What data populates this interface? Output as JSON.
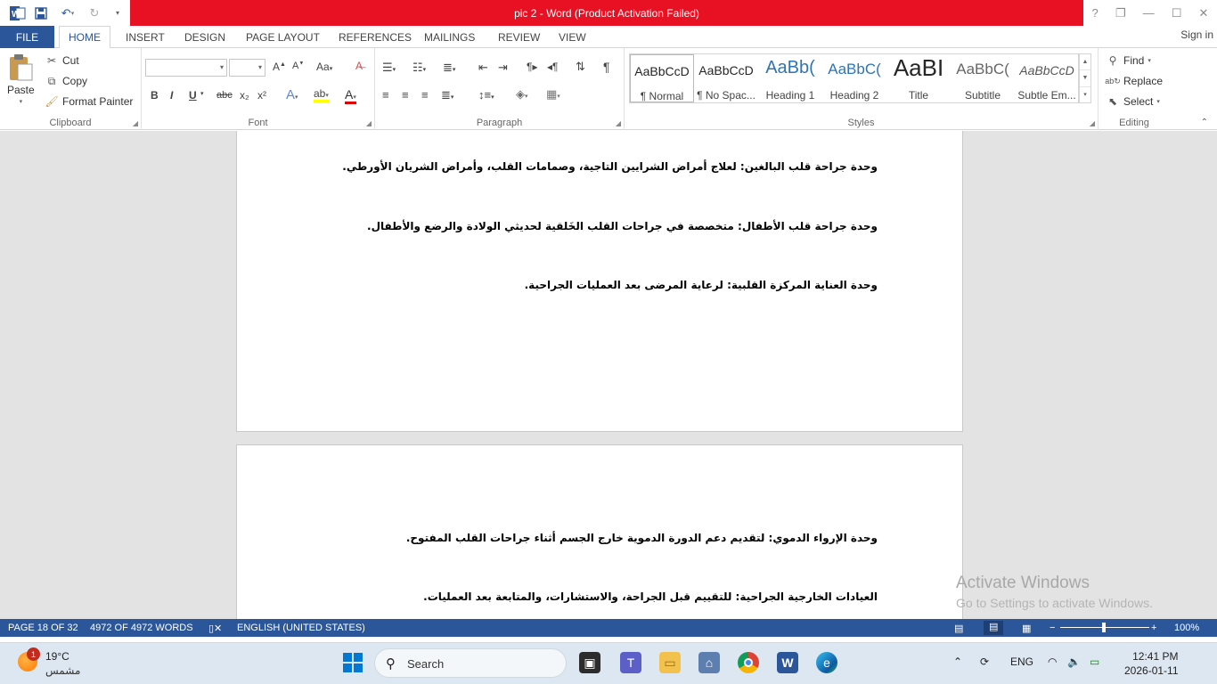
{
  "window": {
    "title": "pic 2 -  Word (Product Activation Failed)",
    "controls": [
      "?",
      "❐",
      "—",
      "☐",
      "✕"
    ]
  },
  "tabs": {
    "file": "FILE",
    "items": [
      "HOME",
      "INSERT",
      "DESIGN",
      "PAGE LAYOUT",
      "REFERENCES",
      "MAILINGS",
      "REVIEW",
      "VIEW"
    ],
    "active": "HOME",
    "signin": "Sign in"
  },
  "ribbon": {
    "clipboard": {
      "label": "Clipboard",
      "paste": "Paste",
      "cut": "Cut",
      "copy": "Copy",
      "format_painter": "Format Painter"
    },
    "font": {
      "label": "Font",
      "font_name": "",
      "font_size": "",
      "bold": "B",
      "italic": "I",
      "underline": "U",
      "strike": "abc",
      "subscript": "x₂",
      "superscript": "x²"
    },
    "paragraph": {
      "label": "Paragraph"
    },
    "styles": {
      "label": "Styles",
      "items": [
        {
          "sample": "AaBbCcD",
          "name": "¶ Normal"
        },
        {
          "sample": "AaBbCcD",
          "name": "¶ No Spac..."
        },
        {
          "sample": "AaBb(",
          "name": "Heading 1"
        },
        {
          "sample": "AaBbC(",
          "name": "Heading 2"
        },
        {
          "sample": "AaBI",
          "name": "Title"
        },
        {
          "sample": "AaBbC(",
          "name": "Subtitle"
        },
        {
          "sample": "AaBbCcD",
          "name": "Subtle Em..."
        }
      ]
    },
    "editing": {
      "label": "Editing",
      "find": "Find",
      "replace": "Replace",
      "select": "Select"
    }
  },
  "document": {
    "page1_paragraphs": [
      "وحدة جراحة قلب البالغين: لعلاج أمراض الشرايين التاجية، وصمامات القلب، وأمراض الشريان الأورطي.",
      "وحدة جراحة قلب الأطفال: متخصصة في جراحات القلب الخَلقية لحديثي الولادة والرضع والأطفال.",
      "وحدة العناية المركزة القلبية: لرعاية المرضى بعد العمليات الجراحية."
    ],
    "page2_paragraphs": [
      "وحدة الإرواء الدموي: لتقديم دعم الدورة الدموية خارج الجسم أثناء جراحات القلب المفتوح.",
      "العيادات الخارجية الجراحية: للتقييم قبل الجراحة، والاستشارات، والمتابعة بعد العمليات."
    ],
    "activation_title": "Activate Windows",
    "activation_sub": "Go to Settings to activate Windows."
  },
  "statusbar": {
    "page": "PAGE 18 OF 32",
    "words": "4972 OF 4972 WORDS",
    "language": "ENGLISH (UNITED STATES)",
    "zoom": "100%"
  },
  "taskbar": {
    "temp": "19°C",
    "weather_desc": "مشمس",
    "badge": "1",
    "search": "Search",
    "lang": "ENG",
    "time": "12:41 PM",
    "date": "2026-01-11"
  },
  "colors": {
    "word_blue": "#2b579a",
    "title_red": "#e81123",
    "doc_bg": "#e3e3e3"
  }
}
